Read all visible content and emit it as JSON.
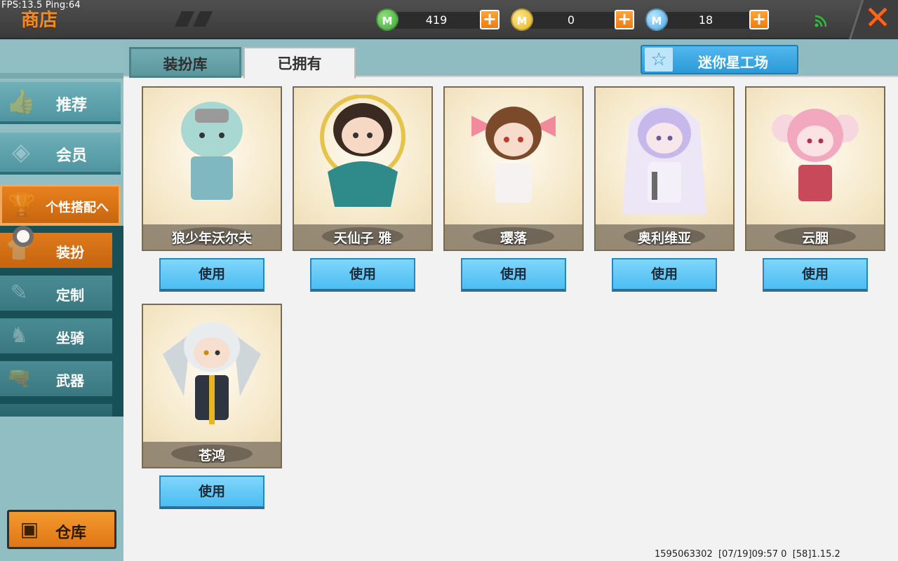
{
  "debug": {
    "fps_text": "FPS:13.5  Ping:64"
  },
  "header": {
    "title": "商店",
    "currencies": [
      {
        "icon": "green-gem-icon",
        "amount": "419",
        "color": "#3fa83a"
      },
      {
        "icon": "gold-coin-icon",
        "amount": "0",
        "color": "#e6b521"
      },
      {
        "icon": "blue-star-coin-icon",
        "amount": "18",
        "color": "#44a8e6"
      }
    ],
    "plus_symbol": "+",
    "close_symbol": "✕"
  },
  "sidebar": {
    "categories": [
      {
        "label": "推荐",
        "icon": "thumbs-up-icon"
      },
      {
        "label": "会员",
        "icon": "member-badge-icon"
      }
    ],
    "active_category": {
      "label": "个性搭配へ",
      "icon": "trophy-icon"
    },
    "subcategories": [
      {
        "label": "装扮",
        "icon": "outfit-icon"
      },
      {
        "label": "定制",
        "icon": "pencil-icon"
      },
      {
        "label": "坐骑",
        "icon": "mount-icon"
      },
      {
        "label": "武器",
        "icon": "gun-icon"
      }
    ],
    "warehouse": {
      "label": "仓库",
      "icon": "chest-icon"
    }
  },
  "tabs": {
    "library": "装扮库",
    "owned": "已拥有"
  },
  "workshop": {
    "label": "迷你星工场",
    "icon": "star-icon"
  },
  "items": [
    {
      "name": "狼少年沃尔夫",
      "button": "使用",
      "palette": {
        "hair": "#a9d8d3",
        "outfit": "#7fb8c0",
        "accent": "#9a9a9a"
      }
    },
    {
      "name": "天仙子 雅",
      "button": "使用",
      "palette": {
        "hair": "#3a2a22",
        "outfit": "#2f8a8a",
        "accent": "#e6c34a"
      }
    },
    {
      "name": "璎落",
      "button": "使用",
      "palette": {
        "hair": "#7a4a2a",
        "outfit": "#f7f2f2",
        "accent": "#f08a9c"
      }
    },
    {
      "name": "奥利维亚",
      "button": "使用",
      "palette": {
        "hair": "#c6b8ea",
        "outfit": "#f3f0fa",
        "accent": "#6a6a6a"
      }
    },
    {
      "name": "云胭",
      "button": "使用",
      "palette": {
        "hair": "#f2a9bf",
        "outfit": "#c84a5a",
        "accent": "#f7d7df"
      }
    },
    {
      "name": "苍鸿",
      "button": "使用",
      "palette": {
        "hair": "#e8ecef",
        "outfit": "#2e3440",
        "accent": "#e6b521"
      }
    }
  ],
  "footer": {
    "info": "1595063302  [07/19]09:57 0  [58]1.15.2"
  }
}
